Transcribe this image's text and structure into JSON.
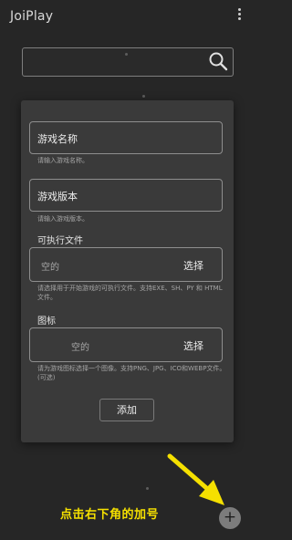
{
  "app": {
    "title": "JoiPlay"
  },
  "search": {
    "value": ""
  },
  "dialog": {
    "game_name": {
      "placeholder": "游戏名称",
      "hint": "请输入游戏名称。"
    },
    "game_version": {
      "placeholder": "游戏版本",
      "hint": "请输入游戏版本。"
    },
    "executable": {
      "label": "可执行文件",
      "empty": "空的",
      "select": "选择",
      "hint": "请选择用于开始游戏的可执行文件。支持EXE、SH、PY 和 HTML 文件。"
    },
    "icon": {
      "label": "图标",
      "empty": "空的",
      "select": "选择",
      "hint": "请为游戏图标选择一个图像。支持PNG、JPG、ICO和WEBP文件。(可选)"
    },
    "add_label": "添加"
  },
  "annotation": {
    "text": "点击右下角的加号",
    "color": "#f5e000"
  },
  "fab": {
    "label": "+"
  },
  "icons": {
    "search": "search-icon",
    "menu": "more-vert-icon",
    "arrow": "arrow-icon"
  }
}
